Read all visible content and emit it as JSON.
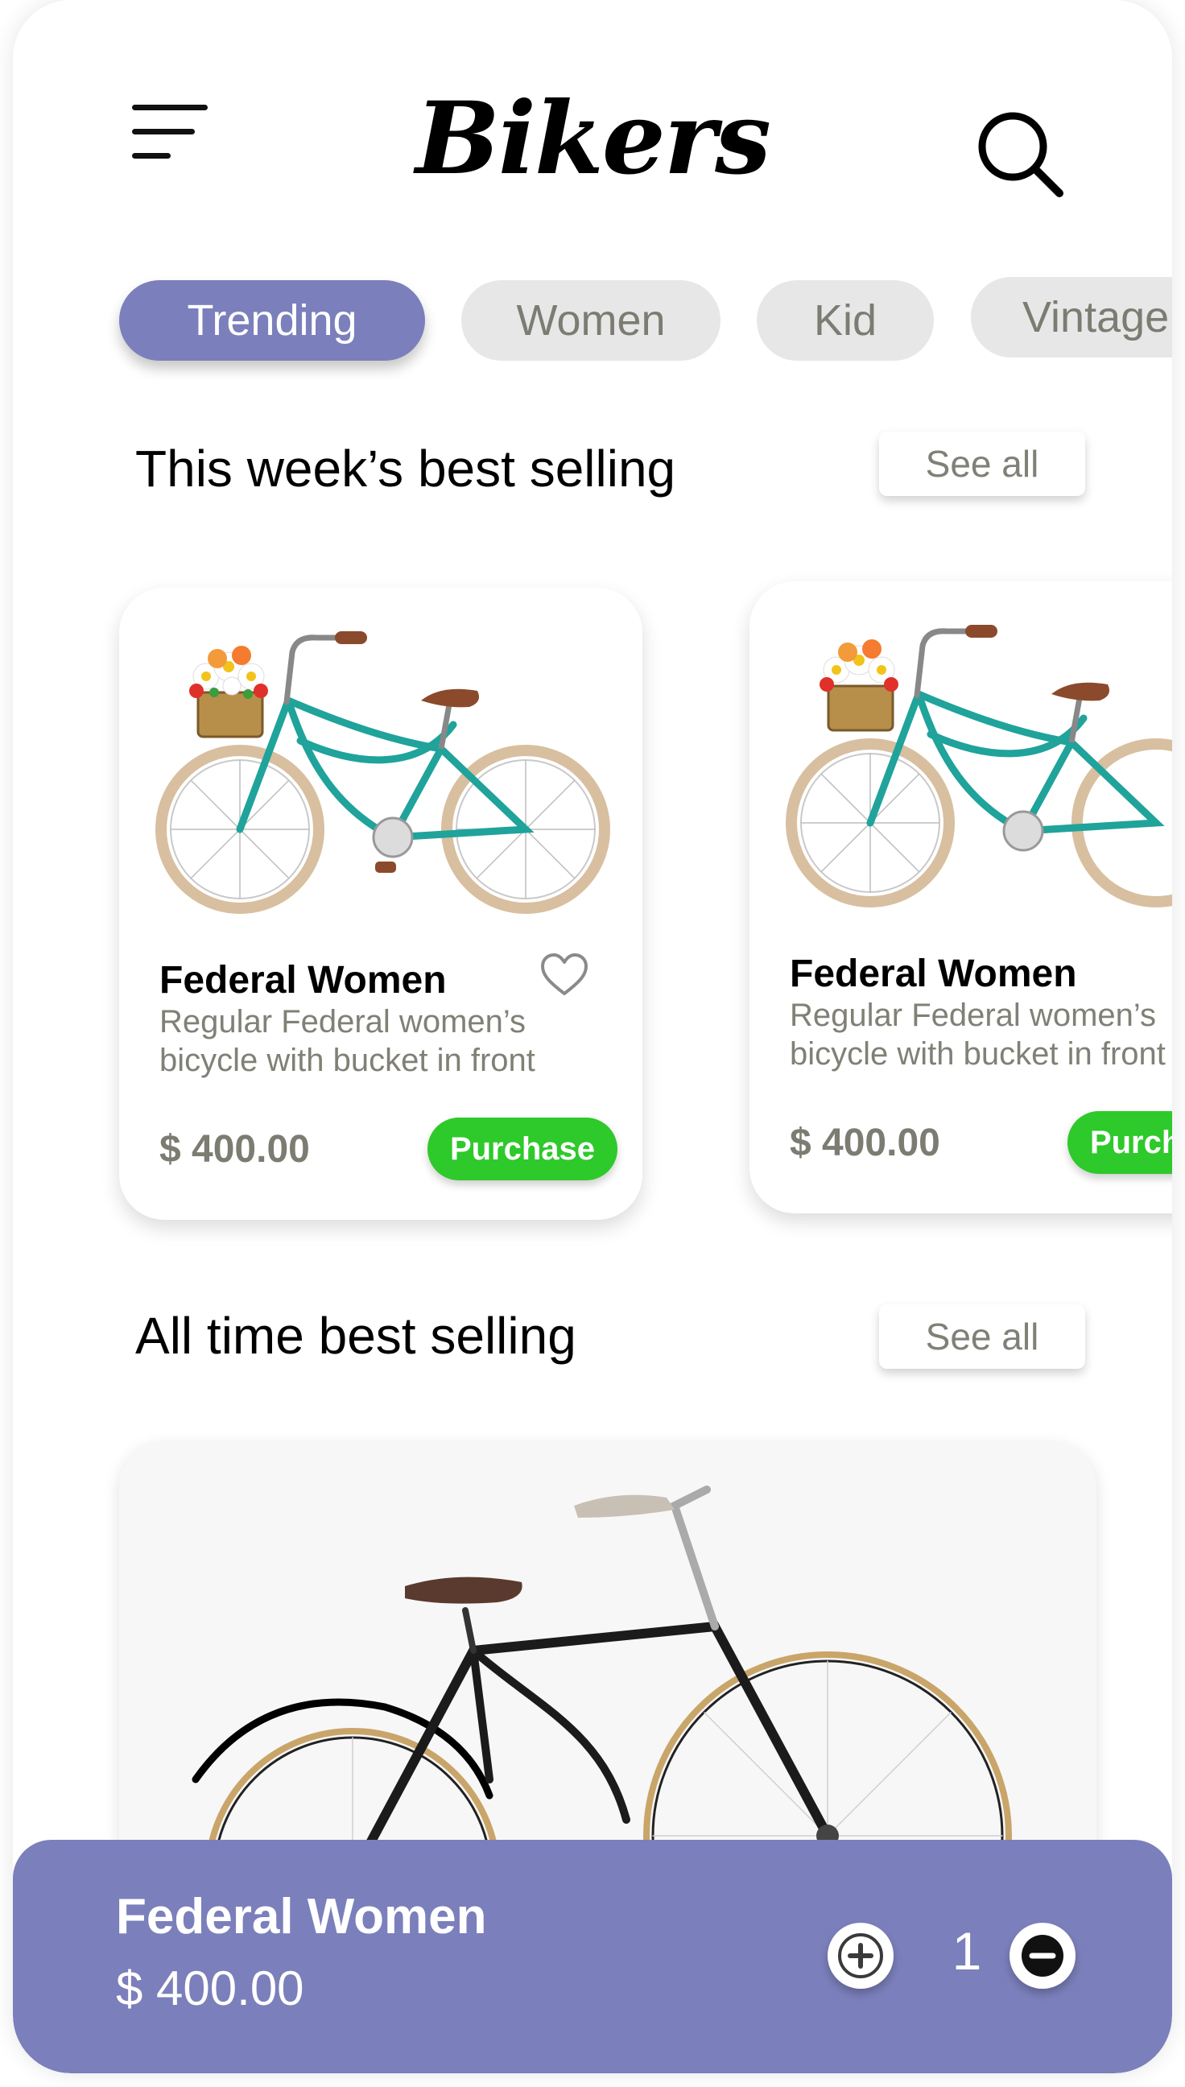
{
  "header": {
    "title": "Bikers",
    "menu_icon": "hamburger-menu-icon",
    "search_icon": "search-icon"
  },
  "categories": [
    {
      "label": "Trending",
      "active": true
    },
    {
      "label": "Women",
      "active": false
    },
    {
      "label": "Kid",
      "active": false
    },
    {
      "label": "Vintage",
      "active": false
    }
  ],
  "weekly_section": {
    "title": "This week’s best selling",
    "see_all": "See all",
    "products": [
      {
        "name": "Federal Women",
        "description": "Regular Federal women’s bicycle with bucket in front",
        "price": "$ 400.00",
        "action": "Purchase"
      },
      {
        "name": "Federal Women",
        "description": "Regular Federal women’s bicycle with bucket in front",
        "price": "$ 400.00",
        "action": "Purchase"
      }
    ]
  },
  "alltime_section": {
    "title": "All time best selling",
    "see_all": "See all"
  },
  "cart_bar": {
    "name": "Federal Women",
    "price": "$ 400.00",
    "quantity": "1"
  },
  "colors": {
    "accent": "#7b7fbb",
    "purchase": "#2ec92a",
    "chip": "#e7e7e7",
    "muted_text": "#808076",
    "bike_frame": "#1fa39b",
    "tire": "#d8bf9f"
  }
}
